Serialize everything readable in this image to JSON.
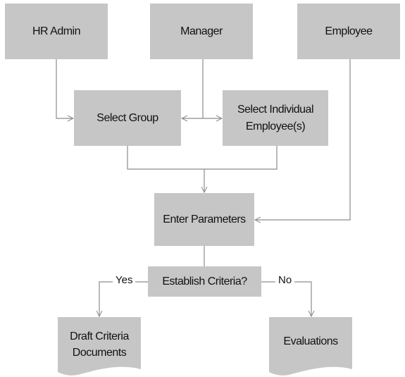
{
  "nodes": {
    "hr_admin": "HR Admin",
    "manager": "Manager",
    "employee": "Employee",
    "select_group": "Select Group",
    "select_individual_1": "Select Individual",
    "select_individual_2": "Employee(s)",
    "enter_parameters": "Enter Parameters",
    "establish_criteria": "Establish Criteria?",
    "draft_criteria_1": "Draft Criteria",
    "draft_criteria_2": "Documents",
    "evaluations": "Evaluations"
  },
  "edges": {
    "yes": "Yes",
    "no": "No"
  },
  "colors": {
    "box": "#c6c6c6",
    "line": "#8c8c8c"
  }
}
